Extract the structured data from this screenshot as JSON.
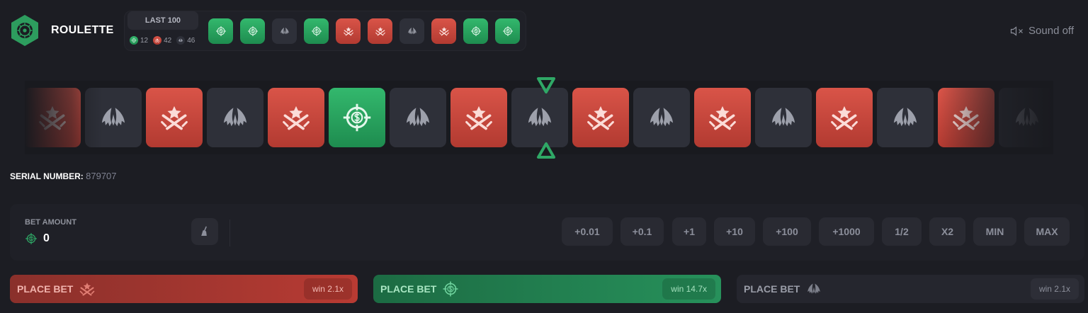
{
  "header": {
    "title": "ROULETTE",
    "logo_icon": "roulette-wheel-icon",
    "last_label": "LAST 100",
    "counts": {
      "green": "12",
      "red": "42",
      "gray": "46"
    },
    "history": [
      "green",
      "green",
      "gray",
      "green",
      "red",
      "red",
      "gray",
      "red",
      "green",
      "green"
    ],
    "sound_label": "Sound off",
    "sound_icon": "speaker-muted-icon"
  },
  "reel": {
    "tiles": [
      "red",
      "gray",
      "red",
      "gray",
      "red",
      "green",
      "gray",
      "red",
      "gray",
      "red",
      "gray",
      "red",
      "gray",
      "red",
      "gray",
      "red",
      "gray"
    ],
    "icons": {
      "green": "target-coin-icon",
      "red": "star-swords-icon",
      "gray": "wings-icon"
    }
  },
  "serial": {
    "label": "SERIAL NUMBER:",
    "value": "879707"
  },
  "bet": {
    "label": "BET AMOUNT",
    "value": "0",
    "clear_icon": "broom-icon",
    "quick_buttons": [
      "+0.01",
      "+0.1",
      "+1",
      "+10",
      "+100",
      "+1000",
      "1/2",
      "X2",
      "MIN",
      "MAX"
    ]
  },
  "place_bets": [
    {
      "label": "PLACE BET",
      "win": "win 2.1x",
      "color": "red"
    },
    {
      "label": "PLACE BET",
      "win": "win 14.7x",
      "color": "green"
    },
    {
      "label": "PLACE BET",
      "win": "win 2.1x",
      "color": "gray"
    }
  ],
  "colors": {
    "green": "#2fa866",
    "red": "#c9473d",
    "gray": "#2e3039",
    "background": "#1c1d23"
  }
}
